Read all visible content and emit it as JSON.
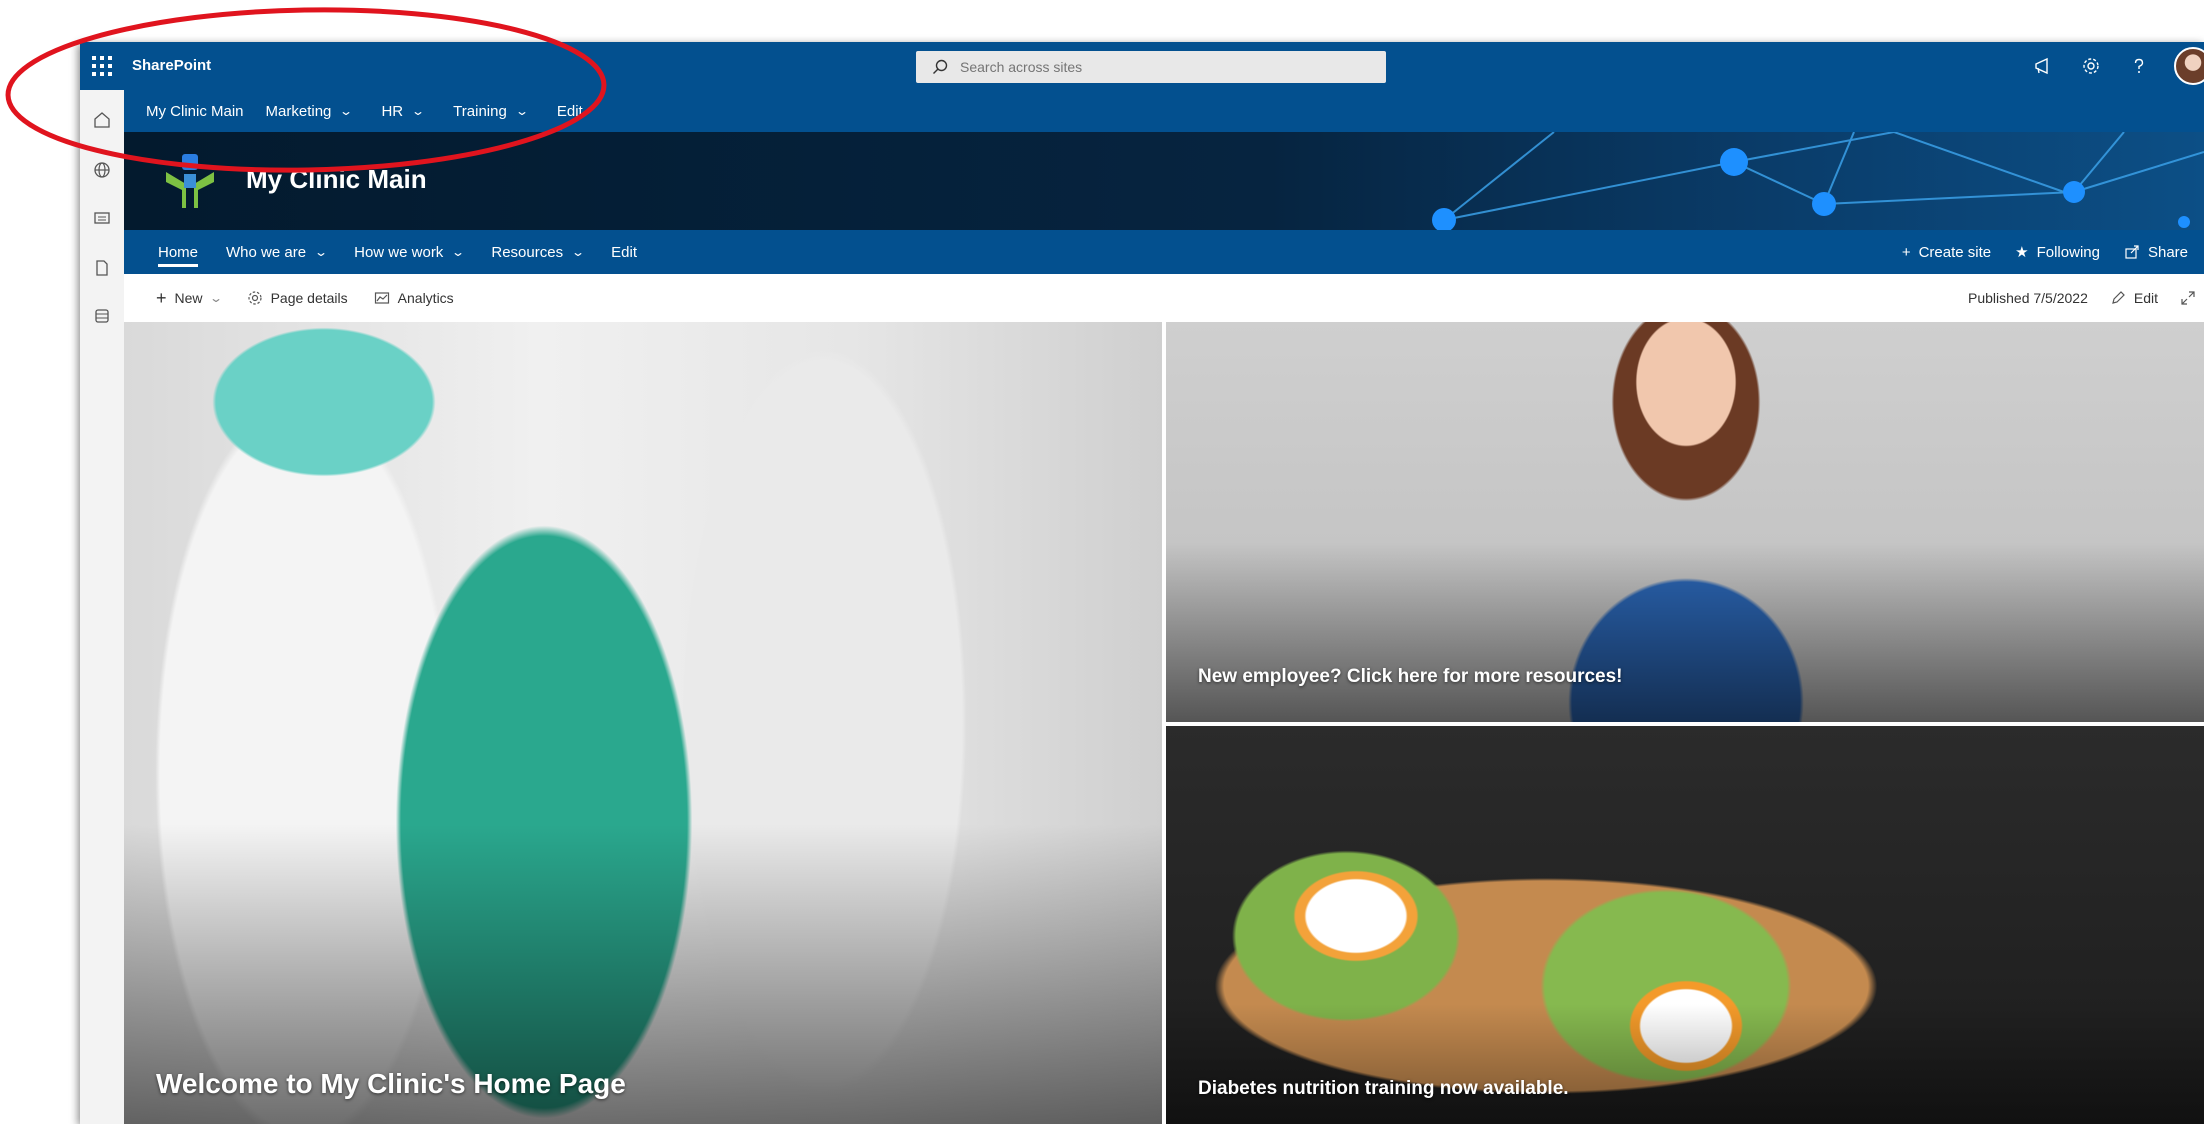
{
  "suitebar": {
    "brand": "SharePoint",
    "search_placeholder": "Search across sites"
  },
  "hubnav": {
    "items": [
      {
        "label": "My Clinic Main",
        "chevron": false
      },
      {
        "label": "Marketing",
        "chevron": true
      },
      {
        "label": "HR",
        "chevron": true
      },
      {
        "label": "Training",
        "chevron": true
      },
      {
        "label": "Edit",
        "chevron": false
      }
    ]
  },
  "site": {
    "title": "My Clinic Main"
  },
  "sitenav": {
    "items": [
      {
        "label": "Home",
        "active": true
      },
      {
        "label": "Who we are",
        "chevron": true
      },
      {
        "label": "How we work",
        "chevron": true
      },
      {
        "label": "Resources",
        "chevron": true
      },
      {
        "label": "Edit"
      }
    ],
    "actions": {
      "create_site": "Create site",
      "following": "Following",
      "share": "Share"
    }
  },
  "cmdbar": {
    "new": "New",
    "page_details": "Page details",
    "analytics": "Analytics",
    "published": "Published 7/5/2022",
    "edit": "Edit"
  },
  "hero": {
    "main_caption": "Welcome to My Clinic's Home Page",
    "tile2_caption": "New employee? Click here for more resources!",
    "tile3_caption": "Diabetes nutrition training now available."
  },
  "colors": {
    "suite_blue": "#03508f",
    "annotation_red": "#e0141e"
  }
}
